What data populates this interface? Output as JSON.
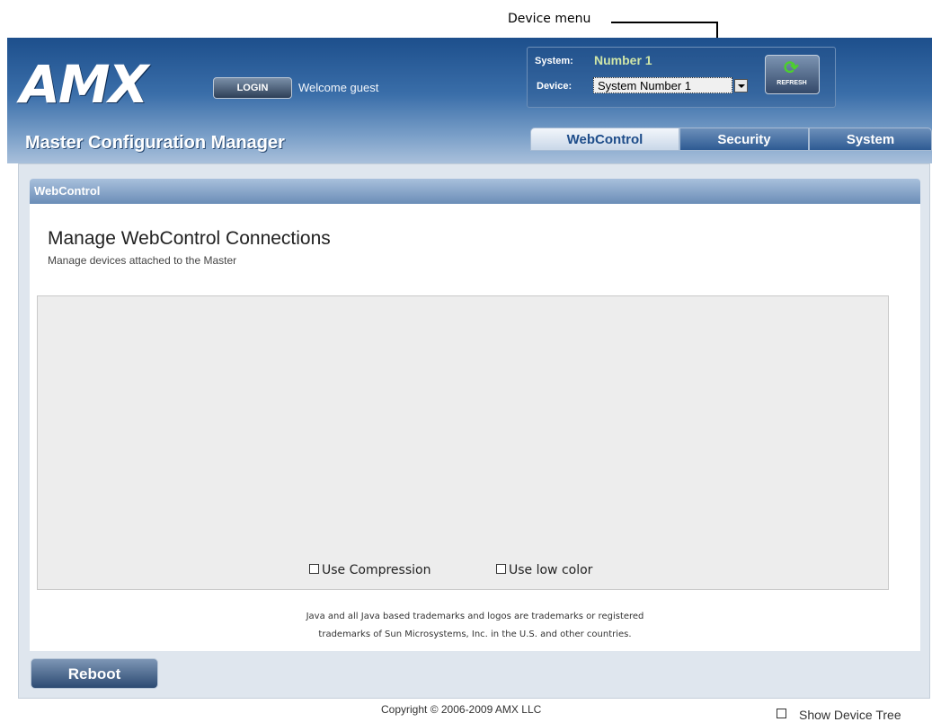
{
  "callout": {
    "label": "Device menu"
  },
  "header": {
    "logo": "AMX",
    "login_label": "LOGIN",
    "welcome": "Welcome guest",
    "system_label": "System:",
    "system_value": "Number 1",
    "device_label": "Device:",
    "device_value": "System Number 1",
    "refresh_label": "REFRESH",
    "app_title": "Master Configuration Manager"
  },
  "tabs": [
    {
      "label": "WebControl",
      "active": true
    },
    {
      "label": "Security",
      "active": false
    },
    {
      "label": "System",
      "active": false
    }
  ],
  "section": {
    "title": "WebControl",
    "heading": "Manage WebControl Connections",
    "subheading": "Manage devices attached to the Master"
  },
  "applet": {
    "use_compression_label": "Use Compression",
    "use_compression_checked": false,
    "use_low_color_label": "Use low color",
    "use_low_color_checked": false
  },
  "trademark": {
    "line1": "Java and all Java based trademarks and logos are trademarks or registered",
    "line2": "trademarks of Sun Microsystems, Inc. in the U.S. and other countries."
  },
  "footer": {
    "reboot_label": "Reboot",
    "copyright": "Copyright © 2006-2009 AMX LLC",
    "show_device_tree_label": "Show Device Tree",
    "show_device_tree_checked": false
  },
  "colors": {
    "header_blue": "#1d4f8c",
    "accent_green": "#4ccf2e",
    "panel_bg": "#dfe6ee"
  }
}
